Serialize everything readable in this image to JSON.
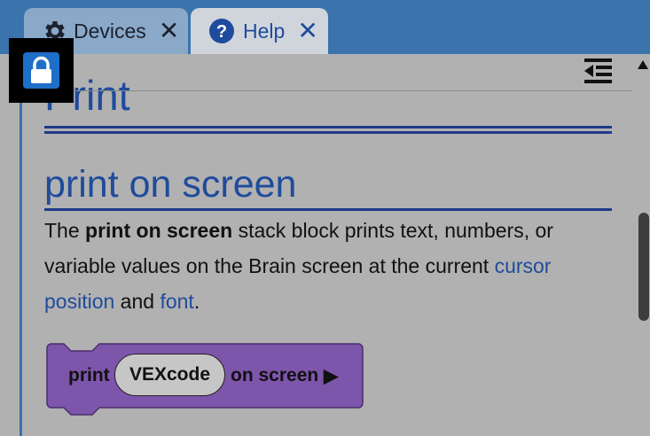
{
  "tabs": [
    {
      "label": "Devices",
      "icon": "gear-icon",
      "close_icon": "close-icon"
    },
    {
      "label": "Help",
      "icon": "help-icon",
      "close_icon": "close-icon"
    }
  ],
  "lock": {
    "icon": "lock-icon"
  },
  "toolbar": {
    "collapse_icon": "collapse-list-icon"
  },
  "doc": {
    "title": "Print",
    "section_title": "print on screen",
    "para": {
      "t1": "The ",
      "b1": "print on screen",
      "t2": " stack block prints text, numbers, or variable values on the Brain screen at the current ",
      "link1": "cursor position",
      "t3": " and ",
      "link2": "font",
      "t4": "."
    }
  },
  "block": {
    "print_label": "print",
    "value": "VEXcode",
    "suffix_label": "on screen",
    "arrow": "▶",
    "color": "#7d55aa"
  },
  "colors": {
    "tabbar": "#3b73ad",
    "heading": "#1f4b9c",
    "background": "#b1b1b1"
  }
}
